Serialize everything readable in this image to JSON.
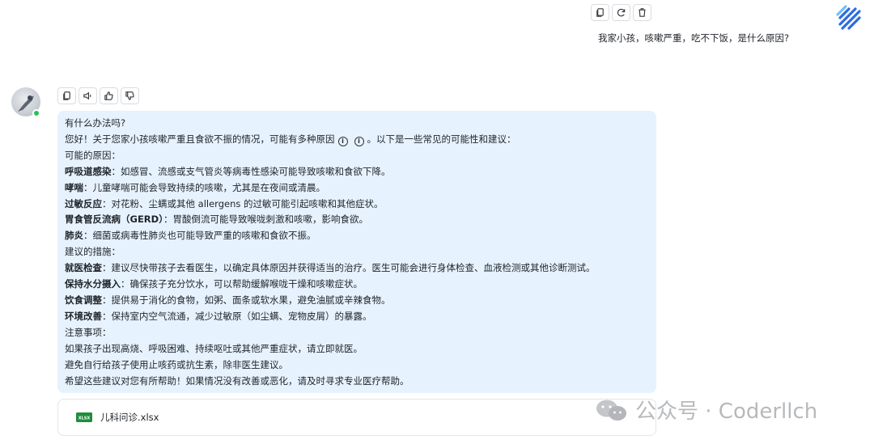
{
  "user": {
    "message": "我家小孩，咳嗽严重，吃不下饭，是什么原因?",
    "toolbar": {
      "copy_icon": "copy-icon",
      "refresh_icon": "refresh-icon",
      "delete_icon": "trash-icon"
    }
  },
  "bot": {
    "toolbar": {
      "copy_icon": "copy-icon",
      "speaker_icon": "speaker-icon",
      "like_icon": "thumbs-up-icon",
      "dislike_icon": "thumbs-down-icon"
    },
    "status_color": "#2dbd5a",
    "bubble_color": "#e6f2fd",
    "lines": {
      "l0": "有什么办法吗?",
      "l1a": "您好！关于您家小孩咳嗽严重且食欲不振的情况，可能有多种原因",
      "l1b": "。以下是一些常见的可能性和建议：",
      "l2": "可能的原因：",
      "l3b": "呼吸道感染",
      "l3": "：如感冒、流感或支气管炎等病毒性感染可能导致咳嗽和食欲下降。",
      "l4b": "哮喘",
      "l4": "：儿童哮喘可能会导致持续的咳嗽，尤其是在夜间或清晨。",
      "l5b": "过敏反应",
      "l5": "：对花粉、尘螨或其他 allergens 的过敏可能引起咳嗽和其他症状。",
      "l6b": "胃食管反流病（GERD）",
      "l6": "：胃酸倒流可能导致喉咙刺激和咳嗽，影响食欲。",
      "l7b": "肺炎",
      "l7": "：细菌或病毒性肺炎也可能导致严重的咳嗽和食欲不振。",
      "l8": "建议的措施：",
      "l9b": "就医检查",
      "l9": "：建议尽快带孩子去看医生，以确定具体原因并获得适当的治疗。医生可能会进行身体检查、血液检测或其他诊断测试。",
      "l10b": "保持水分摄入",
      "l10": "：确保孩子充分饮水，可以帮助缓解喉咙干燥和咳嗽症状。",
      "l11b": "饮食调整",
      "l11": "：提供易于消化的食物，如粥、面条或软水果，避免油腻或辛辣食物。",
      "l12b": "环境改善",
      "l12": "：保持室内空气流通，减少过敏原（如尘螨、宠物皮屑）的暴露。",
      "l13": "注意事项：",
      "l14": "如果孩子出现高烧、呼吸困难、持续呕吐或其他严重症状，请立即就医。",
      "l15": "避免自行给孩子使用止咳药或抗生素，除非医生建议。",
      "l16": "希望这些建议对您有所帮助！如果情况没有改善或恶化，请及时寻求专业医疗帮助。"
    },
    "attachment": {
      "name": "儿科问诊.xlsx",
      "icon": "xlsx-file-icon",
      "icon_label": "XLSX",
      "color": "#1e8e3e"
    }
  },
  "watermark": {
    "text": "公众号 · Coderllch",
    "icon": "wechat-icon"
  }
}
